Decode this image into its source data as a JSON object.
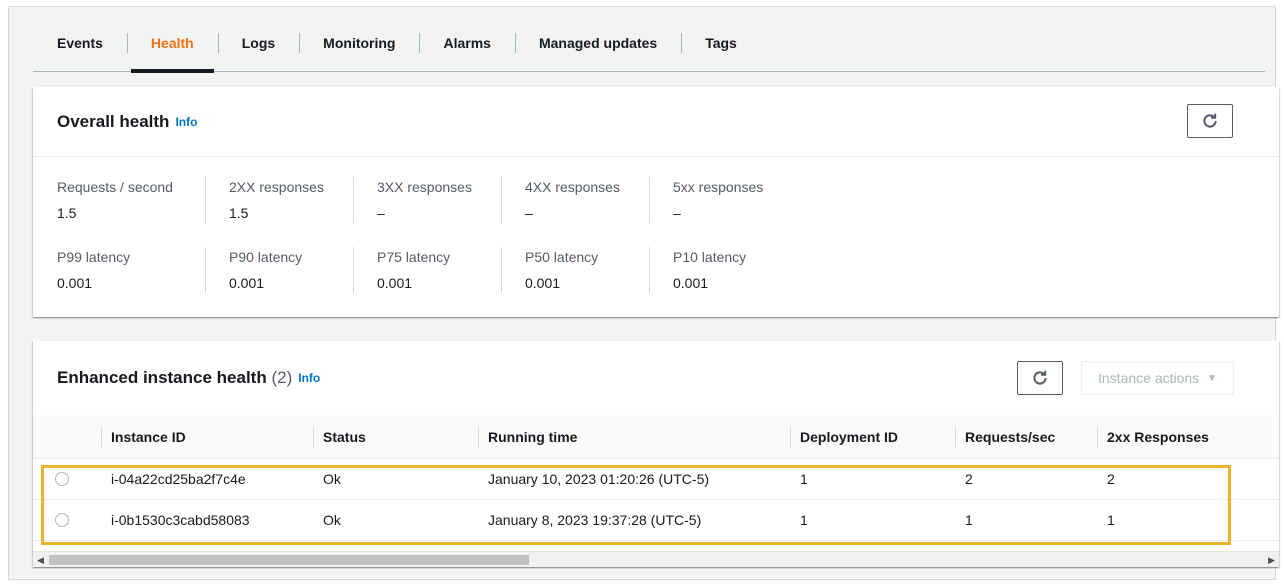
{
  "tabs": [
    {
      "label": "Events",
      "active": false
    },
    {
      "label": "Health",
      "active": true
    },
    {
      "label": "Logs",
      "active": false
    },
    {
      "label": "Monitoring",
      "active": false
    },
    {
      "label": "Alarms",
      "active": false
    },
    {
      "label": "Managed updates",
      "active": false
    },
    {
      "label": "Tags",
      "active": false
    }
  ],
  "overall_health": {
    "title": "Overall health",
    "info": "Info",
    "refresh_icon": "refresh-icon",
    "metrics_row1": [
      {
        "label": "Requests / second",
        "value": "1.5"
      },
      {
        "label": "2XX responses",
        "value": "1.5"
      },
      {
        "label": "3XX responses",
        "value": "–"
      },
      {
        "label": "4XX responses",
        "value": "–"
      },
      {
        "label": "5xx responses",
        "value": "–"
      }
    ],
    "metrics_row2": [
      {
        "label": "P99 latency",
        "value": "0.001"
      },
      {
        "label": "P90 latency",
        "value": "0.001"
      },
      {
        "label": "P75 latency",
        "value": "0.001"
      },
      {
        "label": "P50 latency",
        "value": "0.001"
      },
      {
        "label": "P10 latency",
        "value": "0.001"
      }
    ]
  },
  "instance_health": {
    "title": "Enhanced instance health",
    "count": "(2)",
    "info": "Info",
    "actions_label": "Instance actions",
    "columns": [
      "Instance ID",
      "Status",
      "Running time",
      "Deployment ID",
      "Requests/sec",
      "2xx Responses"
    ],
    "rows": [
      {
        "id": "i-04a22cd25ba2f7c4e",
        "status": "Ok",
        "running_time": "January 10, 2023 01:20:26 (UTC-5)",
        "deployment_id": "1",
        "requests_sec": "2",
        "responses_2xx": "2"
      },
      {
        "id": "i-0b1530c3cabd58083",
        "status": "Ok",
        "running_time": "January 8, 2023 19:37:28 (UTC-5)",
        "deployment_id": "1",
        "requests_sec": "1",
        "responses_2xx": "1"
      }
    ]
  },
  "colors": {
    "accent": "#ec7211",
    "link": "#0073bb",
    "highlight": "#e8b62a"
  }
}
